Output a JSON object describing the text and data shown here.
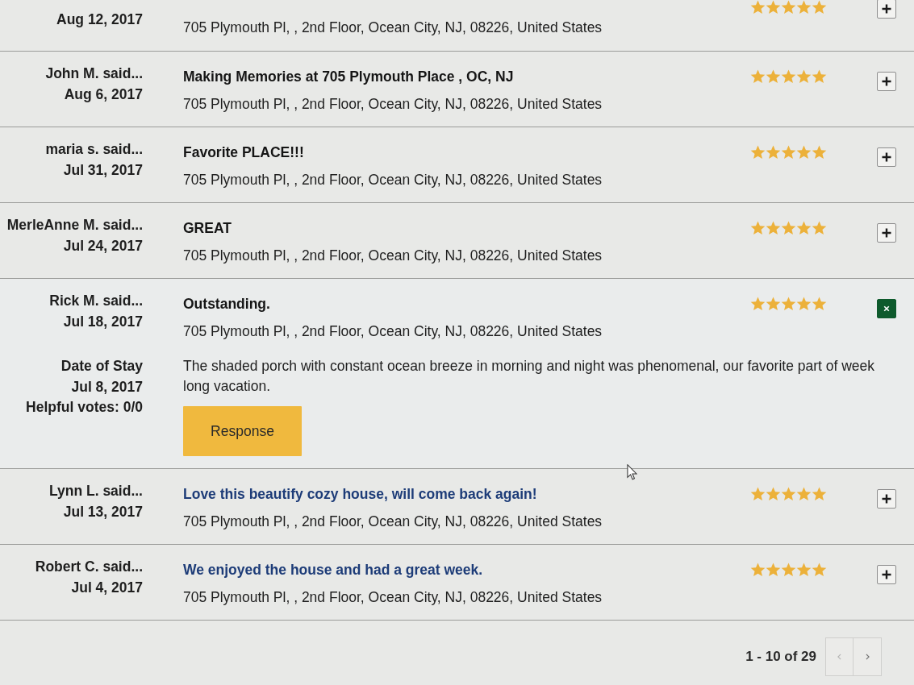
{
  "reviews": [
    {
      "date": "Aug 12, 2017",
      "address": "705 Plymouth Pl, , 2nd Floor, Ocean City, NJ, 08226, United States",
      "stars": 5,
      "expanded": false
    },
    {
      "author": "John M. said...",
      "date": "Aug 6, 2017",
      "title": "Making Memories at 705 Plymouth Place , OC, NJ",
      "color": "#151515",
      "address": "705 Plymouth Pl, , 2nd Floor, Ocean City, NJ, 08226, United States",
      "stars": 5,
      "expanded": false
    },
    {
      "author": "maria s. said...",
      "date": "Jul 31, 2017",
      "title": "Favorite PLACE!!!",
      "color": "#151515",
      "address": "705 Plymouth Pl, , 2nd Floor, Ocean City, NJ, 08226, United States",
      "stars": 5,
      "expanded": false
    },
    {
      "author": "MerleAnne M. said...",
      "date": "Jul 24, 2017",
      "title": "GREAT",
      "color": "#151515",
      "address": "705 Plymouth Pl, , 2nd Floor, Ocean City, NJ, 08226, United States",
      "stars": 5,
      "expanded": false
    },
    {
      "author": "Rick M. said...",
      "date": "Jul 18, 2017",
      "title": "Outstanding.",
      "color": "#151515",
      "address": "705 Plymouth Pl, , 2nd Floor, Ocean City, NJ, 08226, United States",
      "stars": 5,
      "expanded": true,
      "details": {
        "stay_label": "Date of Stay",
        "stay_date": "Jul 8, 2017",
        "helpful_votes": "Helpful votes: 0/0",
        "text": "The shaded porch with constant ocean breeze in morning and night was phenomenal, our favorite part of week long vacation.",
        "response_button": "Response"
      }
    },
    {
      "author": "Lynn L. said...",
      "date": "Jul 13, 2017",
      "title": "Love this beautify cozy house, will come back again!",
      "color": "#1d3c78",
      "address": "705 Plymouth Pl, , 2nd Floor, Ocean City, NJ, 08226, United States",
      "stars": 5,
      "expanded": false
    },
    {
      "author": "Robert C. said...",
      "date": "Jul 4, 2017",
      "title": "We enjoyed the house and had a great week.",
      "color": "#1d3c78",
      "address": "705 Plymouth Pl, , 2nd Floor, Ocean City, NJ, 08226, United States",
      "stars": 5,
      "expanded": false
    }
  ],
  "pagination": {
    "range": "1 - 10 of 29",
    "prev_disabled": true,
    "next_disabled": false
  }
}
